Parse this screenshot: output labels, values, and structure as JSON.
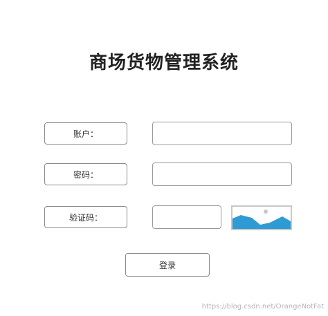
{
  "app": {
    "title": "商场货物管理系统"
  },
  "form": {
    "account_label": "账户：",
    "password_label": "密码：",
    "captcha_label": "验证码：",
    "account_value": "",
    "password_value": "",
    "captcha_value": "",
    "login_label": "登录"
  },
  "captcha_image": {
    "icon": "image-placeholder-icon",
    "sky_color": "#ffffff",
    "mountain_color": "#2e9bd4",
    "sun_color": "#c8c8c8"
  },
  "watermark": {
    "text": "https://blog.csdn.net/OrangeNotFat"
  }
}
